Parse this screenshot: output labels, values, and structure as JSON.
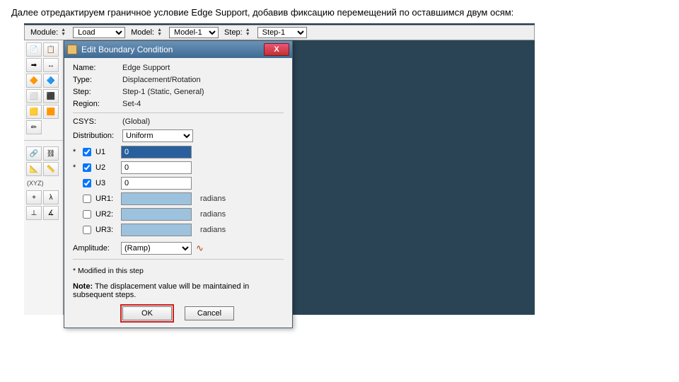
{
  "caption": "Далее отредактируем граничное условие Edge Support, добавив фиксацию перемещений по оставшимся двум осям:",
  "context": {
    "module_label": "Module:",
    "module_value": "Load",
    "model_label": "Model:",
    "model_value": "Model-1",
    "step_label": "Step:",
    "step_value": "Step-1"
  },
  "toolbox": {
    "xyz": "(XYZ)"
  },
  "dialog": {
    "title": "Edit Boundary Condition",
    "fields": {
      "name_k": "Name:",
      "name_v": "Edge Support",
      "type_k": "Type:",
      "type_v": "Displacement/Rotation",
      "step_k": "Step:",
      "step_v": "Step-1 (Static, General)",
      "region_k": "Region:",
      "region_v": "Set-4",
      "csys_k": "CSYS:",
      "csys_v": "(Global)",
      "dist_k": "Distribution:",
      "dist_v": "Uniform"
    },
    "dof": [
      {
        "star": "*",
        "chk": true,
        "name": "U1",
        "val": "0",
        "cls": "sel",
        "unit": ""
      },
      {
        "star": "*",
        "chk": true,
        "name": "U2",
        "val": "0",
        "cls": "",
        "unit": ""
      },
      {
        "star": "",
        "chk": true,
        "name": "U3",
        "val": "0",
        "cls": "",
        "unit": ""
      },
      {
        "star": "",
        "chk": false,
        "name": "UR1:",
        "val": "",
        "cls": "blue",
        "unit": "radians"
      },
      {
        "star": "",
        "chk": false,
        "name": "UR2:",
        "val": "",
        "cls": "blue",
        "unit": "radians"
      },
      {
        "star": "",
        "chk": false,
        "name": "UR3:",
        "val": "",
        "cls": "blue",
        "unit": "radians"
      }
    ],
    "amp_k": "Amplitude:",
    "amp_v": "(Ramp)",
    "mod_note": "* Modified in this step",
    "note_b": "Note:",
    "note_t": " The displacement value will be maintained in subsequent steps.",
    "ok": "OK",
    "cancel": "Cancel"
  }
}
